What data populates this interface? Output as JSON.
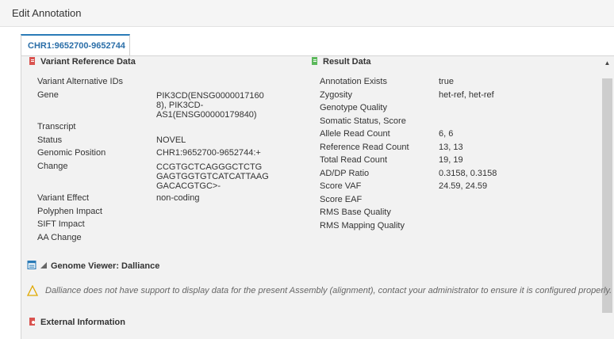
{
  "window": {
    "title": "Edit Annotation"
  },
  "tab": {
    "label": "CHR1:9652700-9652744"
  },
  "variant_reference": {
    "header": "Variant Reference Data",
    "rows": [
      {
        "label": "Variant Alternative IDs",
        "value": ""
      },
      {
        "label": "Gene",
        "value": "PIK3CD(ENSG0000017160\n8), PIK3CD-\nAS1(ENSG00000179840)"
      },
      {
        "label": "Transcript",
        "value": ""
      },
      {
        "label": "Status",
        "value": "NOVEL"
      },
      {
        "label": "Genomic Position",
        "value": "CHR1:9652700-9652744:+"
      },
      {
        "label": "Change",
        "value": "CCGTGCTCAGGGCTCTG\nGAGTGGTGTCATCATTAAG\nGACACGTGC>-"
      },
      {
        "label": "Variant Effect",
        "value": "non-coding"
      },
      {
        "label": "Polyphen Impact",
        "value": ""
      },
      {
        "label": "SIFT Impact",
        "value": ""
      },
      {
        "label": "AA Change",
        "value": ""
      }
    ]
  },
  "result_data": {
    "header": "Result Data",
    "rows": [
      {
        "label": "Annotation Exists",
        "value": "true"
      },
      {
        "label": "Zygosity",
        "value": "het-ref, het-ref"
      },
      {
        "label": "Genotype Quality",
        "value": ""
      },
      {
        "label": "Somatic Status, Score",
        "value": ""
      },
      {
        "label": "Allele Read Count",
        "value": "6, 6"
      },
      {
        "label": "Reference Read Count",
        "value": "13, 13"
      },
      {
        "label": "Total Read Count",
        "value": "19, 19"
      },
      {
        "label": "AD/DP Ratio",
        "value": "0.3158, 0.3158"
      },
      {
        "label": "Score VAF",
        "value": "24.59, 24.59"
      },
      {
        "label": "Score EAF",
        "value": ""
      },
      {
        "label": "RMS Base Quality",
        "value": ""
      },
      {
        "label": "RMS Mapping Quality",
        "value": ""
      }
    ]
  },
  "genome_viewer": {
    "header": "Genome Viewer: Dalliance",
    "message": "Dalliance does not have support to display data for the present Assembly (alignment), contact your administrator to ensure it is configured properly."
  },
  "external_information": {
    "header": "External Information"
  },
  "colors": {
    "accent": "#2a7bb7",
    "warning": "#e0a800",
    "vrd_icon": "#d9534f",
    "result_icon": "#5cb85c",
    "viewer_icon": "#2a7bb7"
  },
  "icons": {
    "variant_reference": "document-red-icon",
    "result_data": "document-green-icon",
    "genome_viewer": "window-icon",
    "external_information": "link-red-icon",
    "warning": "warning-triangle-icon",
    "collapse": "caret-up-icon"
  }
}
